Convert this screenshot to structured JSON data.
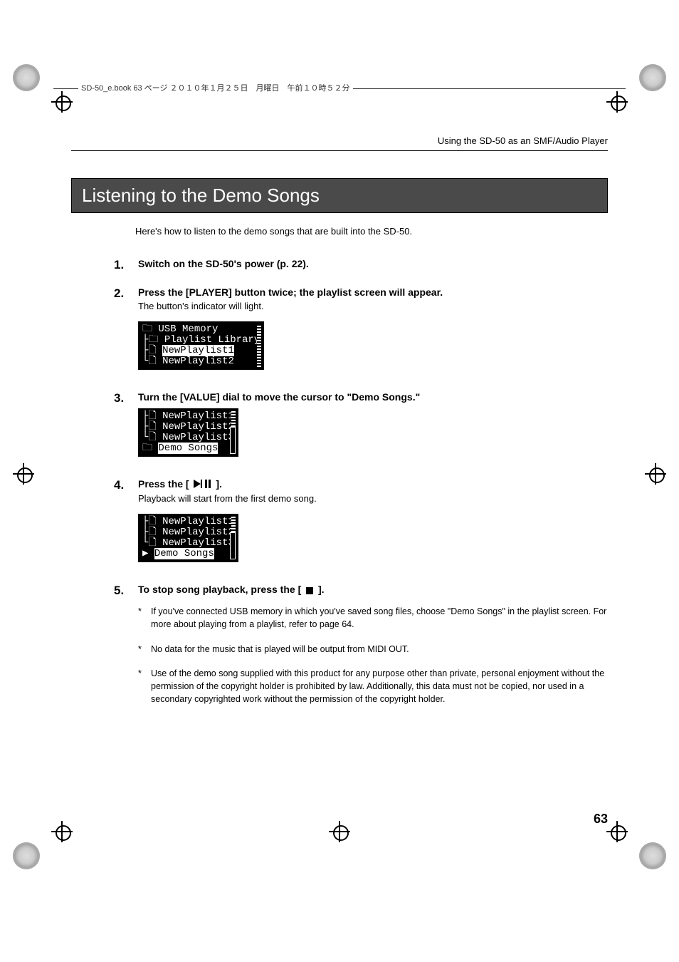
{
  "book_label": "SD-50_e.book  63 ページ  ２０１０年１月２５日　月曜日　午前１０時５２分",
  "running_head": "Using the SD-50 as an SMF/Audio Player",
  "section_title": "Listening to the Demo Songs",
  "intro": "Here's how to listen to the demo songs that are built into the SD-50.",
  "steps": [
    {
      "head": "Switch on the SD-50's power (p. 22)."
    },
    {
      "head": "Press the [PLAYER] button twice; the playlist screen will appear.",
      "sub": "The button's indicator will light.",
      "lcd": {
        "lines": [
          {
            "prefix": "🗀 ",
            "text": "USB Memory"
          },
          {
            "prefix": "├🗀 ",
            "text": "Playlist Library"
          },
          {
            "prefix": "├🗋 ",
            "text": "NewPlaylist1",
            "selected": true
          },
          {
            "prefix": "└🗋 ",
            "text": "NewPlaylist2"
          }
        ],
        "scrollbar_full": true
      }
    },
    {
      "head": "Turn the [VALUE] dial to move the cursor to \"Demo Songs.\"",
      "lcd": {
        "lines": [
          {
            "prefix": "├🗋 ",
            "text": "NewPlaylist1"
          },
          {
            "prefix": "├🗋 ",
            "text": "NewPlaylist2"
          },
          {
            "prefix": "└🗋 ",
            "text": "NewPlaylist3"
          },
          {
            "prefix": "🗀 ",
            "text": "Demo Songs",
            "selected": true
          }
        ],
        "scrollbar_top_only": true
      }
    },
    {
      "head_before": "Press the [ ",
      "head_after": " ].",
      "icon": "playpause",
      "sub": "Playback will start from the first demo song.",
      "lcd": {
        "lines": [
          {
            "prefix": "├🗋 ",
            "text": "NewPlaylist1"
          },
          {
            "prefix": "├🗋 ",
            "text": "NewPlaylist2"
          },
          {
            "prefix": "└🗋 ",
            "text": "NewPlaylist3"
          },
          {
            "prefix": "▶ ",
            "text": "Demo Songs",
            "selected": true
          }
        ],
        "scrollbar_top_only": true
      }
    },
    {
      "head_before": "To stop song playback, press the [ ",
      "head_after": " ].",
      "icon": "stop",
      "notes": [
        "If you've connected USB memory in which you've saved song files, choose \"Demo Songs\" in the playlist screen. For more about playing from a playlist, refer to page 64.",
        "No data for the music that is played will be output from MIDI OUT.",
        "Use of the demo song supplied with this product for any purpose other than private, personal enjoyment without the permission of the copyright holder is prohibited by law. Additionally, this data must not be copied, nor used in a secondary copyrighted work without the permission of the copyright holder."
      ]
    }
  ],
  "page_number": "63"
}
